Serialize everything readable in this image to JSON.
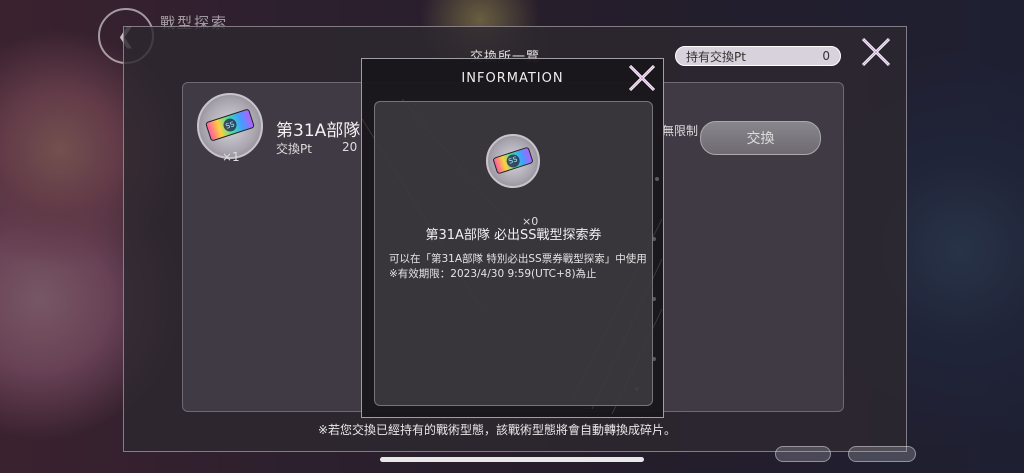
{
  "background": {
    "title": "戰型探索",
    "back_icon": "back-arrow-icon"
  },
  "main_panel": {
    "title": "交換所一覽",
    "points_label": "持有交換Pt",
    "points_value": "0",
    "close_icon": "close-x-icon",
    "item": {
      "name": "第31A部隊",
      "quantity": "×1",
      "pt_label": "交換Pt",
      "pt_value": "20",
      "limit_label": "無限制",
      "exchange_label": "交換"
    },
    "footer_note": "※若您交換已經持有的戰術型態，該戰術型態將會自動轉換成碎片。"
  },
  "info_modal": {
    "title": "INFORMATION",
    "close_icon": "close-x-icon",
    "item_name": "第31A部隊 必出SS戰型探索券",
    "quantity": "×0",
    "description_line1": "可以在「第31A部隊 特別必出SS票券戰型探索」中使用",
    "description_line2": "※有效期限：2023/4/30 9:59(UTC+8)為止",
    "ticket_badge": "SS"
  },
  "colors": {
    "panel_border": "#dcd7e1",
    "pill_bg": "#e6e1eb",
    "button_bg": "#7c7880"
  }
}
